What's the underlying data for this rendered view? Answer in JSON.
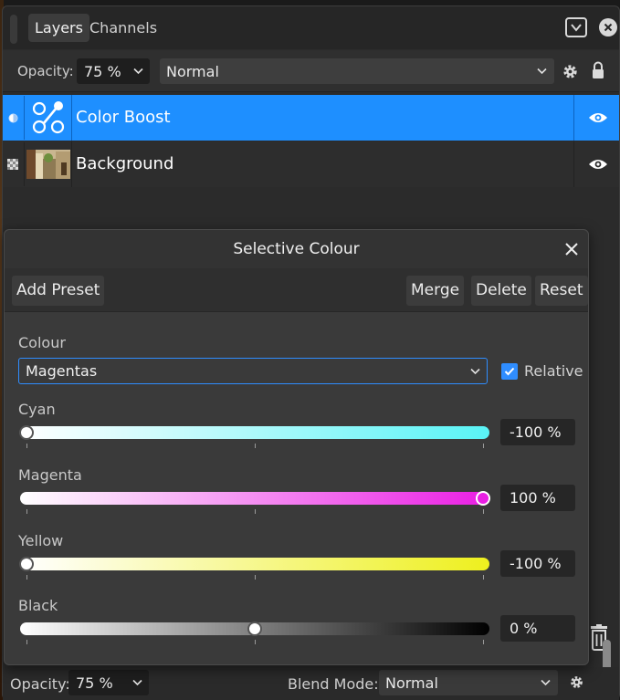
{
  "tabs": [
    {
      "label": "Layers",
      "active": true
    },
    {
      "label": "Channels",
      "active": false
    }
  ],
  "top_controls": {
    "opacity_label": "Opacity:",
    "opacity_value": "75 %",
    "blend_mode": "Normal"
  },
  "layers": [
    {
      "name": "Color Boost",
      "selected": true,
      "thumbnail_icon": "adjustment-icon",
      "visible": true
    },
    {
      "name": "Background",
      "selected": false,
      "thumbnail_icon": "image-thumbnail",
      "visible": true
    }
  ],
  "dialog": {
    "title": "Selective Colour",
    "toolbar": {
      "add_preset": "Add Preset",
      "merge": "Merge",
      "delete": "Delete",
      "reset": "Reset"
    },
    "colour_label": "Colour",
    "colour_selected": "Magentas",
    "relative_label": "Relative",
    "relative_checked": true,
    "sliders": [
      {
        "label": "Cyan",
        "value_text": "-100 %",
        "value": -100,
        "min": -100,
        "max": 100,
        "gradient": [
          "#ffffff",
          "#59f3f6"
        ]
      },
      {
        "label": "Magenta",
        "value_text": "100 %",
        "value": 100,
        "min": -100,
        "max": 100,
        "gradient": [
          "#ffffff",
          "#ea1ee4"
        ]
      },
      {
        "label": "Yellow",
        "value_text": "-100 %",
        "value": -100,
        "min": -100,
        "max": 100,
        "gradient": [
          "#ffffff",
          "#eef01e"
        ]
      },
      {
        "label": "Black",
        "value_text": "0 %",
        "value": 0,
        "min": -100,
        "max": 100,
        "gradient": [
          "#ffffff",
          "#000000"
        ]
      }
    ]
  },
  "bottom_bar": {
    "opacity_label": "Opacity:",
    "opacity_value": "75 %",
    "blend_label": "Blend Mode:",
    "blend_value": "Normal"
  },
  "colors": {
    "accent": "#1e8fff",
    "panel": "#2b2b2b",
    "dialog": "#3a3a3a"
  }
}
